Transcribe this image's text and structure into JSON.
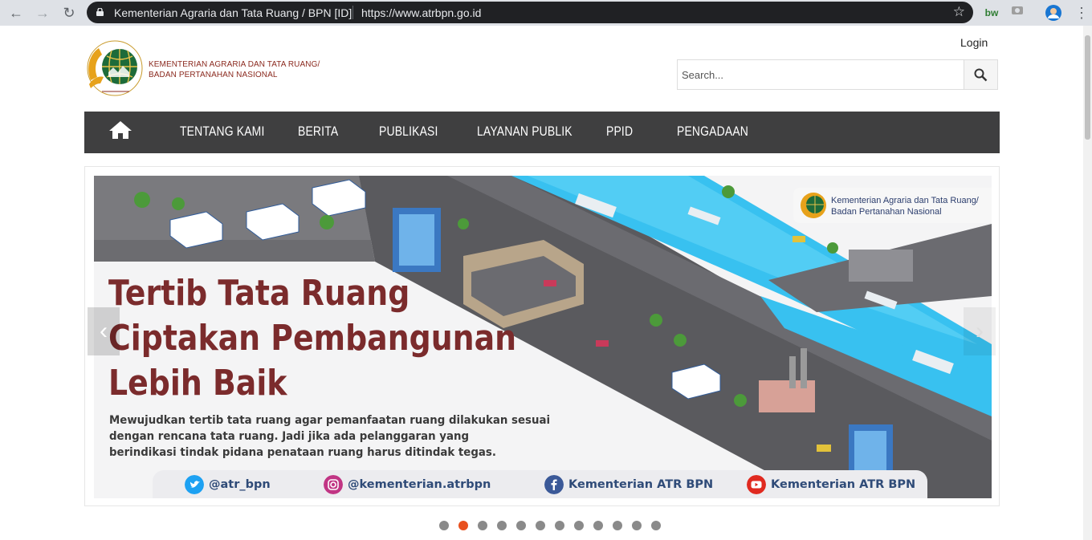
{
  "browser": {
    "tab_title": "Kementerian Agraria dan Tata Ruang / BPN [ID]",
    "url": "https://www.atrbpn.go.id",
    "extension_label": "bw"
  },
  "header": {
    "org_line1": "KEMENTERIAN AGRARIA DAN TATA RUANG/",
    "org_line2": "BADAN PERTANAHAN NASIONAL",
    "login_label": "Login"
  },
  "search": {
    "placeholder": "Search..."
  },
  "nav": {
    "items": [
      {
        "label": "TENTANG KAMI"
      },
      {
        "label": "BERITA"
      },
      {
        "label": "PUBLIKASI"
      },
      {
        "label": "LAYANAN PUBLIK"
      },
      {
        "label": "PPID"
      },
      {
        "label": "PENGADAAN"
      }
    ]
  },
  "slide": {
    "headline_line1": "Tertib Tata Ruang",
    "headline_line2": "Ciptakan Pembangunan",
    "headline_line3": "Lebih Baik",
    "body_line1": "Mewujudkan tertib tata ruang agar pemanfaatan ruang dilakukan sesuai",
    "body_line2": "dengan rencana tata ruang. Jadi jika ada pelanggaran yang",
    "body_line3": "berindikasi tindak pidana penataan ruang harus ditindak tegas.",
    "logo_line1": "Kementerian Agraria dan Tata Ruang/",
    "logo_line2": "Badan Pertanahan Nasional",
    "social": {
      "twitter": "@atr_bpn",
      "instagram": "@kementerian.atrbpn",
      "facebook": "Kementerian ATR BPN",
      "youtube": "Kementerian ATR BPN"
    },
    "colors": {
      "headline": "#7b2b2c",
      "river": "#38c1f0",
      "road": "#5a5a5e"
    }
  },
  "carousel": {
    "slide_count": 12,
    "active_index": 1
  },
  "colors": {
    "nav_bg": "#3f3f40",
    "active_dot": "#e8501e",
    "dot": "#8a8a8a"
  }
}
